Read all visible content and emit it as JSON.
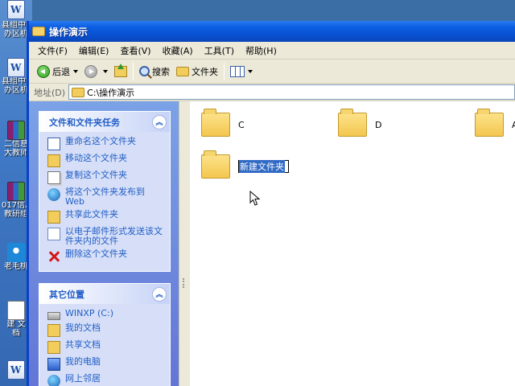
{
  "desktop": {
    "icons": [
      {
        "label": "",
        "type": "word"
      },
      {
        "label": "县组中学",
        "type": "word2"
      },
      {
        "label": "办区机",
        "type": "word2"
      },
      {
        "label": "县组中学",
        "type": "word"
      },
      {
        "label": "办区机",
        "type": "word"
      },
      {
        "label": "二信息",
        "type": "rar"
      },
      {
        "label": "大教师",
        "type": "rar"
      },
      {
        "label": "017信息",
        "type": "rar"
      },
      {
        "label": "教研组",
        "type": "rar"
      },
      {
        "label": "老毛桃",
        "type": "qq"
      },
      {
        "label": "建 文",
        "type": "doc"
      },
      {
        "label": "档",
        "type": "doc"
      },
      {
        "label": "",
        "type": "word"
      }
    ]
  },
  "window": {
    "title": "操作演示",
    "menu": [
      "文件(F)",
      "编辑(E)",
      "查看(V)",
      "收藏(A)",
      "工具(T)",
      "帮助(H)"
    ],
    "toolbar": {
      "back_label": "后退",
      "search_label": "搜索",
      "folders_label": "文件夹"
    },
    "address": {
      "label": "地址(D)",
      "path": "C:\\操作演示"
    }
  },
  "taskpane": {
    "file_tasks": {
      "title": "文件和文件夹任务",
      "items": [
        {
          "text": "重命名这个文件夹",
          "icon": "rename-icon"
        },
        {
          "text": "移动这个文件夹",
          "icon": "move-icon"
        },
        {
          "text": "复制这个文件夹",
          "icon": "copy-icon"
        },
        {
          "text": "将这个文件夹发布到Web",
          "icon": "web-publish-icon"
        },
        {
          "text": "共享此文件夹",
          "icon": "share-icon"
        },
        {
          "text": "以电子邮件形式发送该文件夹内的文件",
          "icon": "email-icon"
        },
        {
          "text": "删除这个文件夹",
          "icon": "delete-icon"
        }
      ]
    },
    "other_places": {
      "title": "其它位置",
      "items": [
        {
          "text": "WINXP (C:)",
          "icon": "drive-icon"
        },
        {
          "text": "我的文档",
          "icon": "my-documents-icon"
        },
        {
          "text": "共享文档",
          "icon": "shared-documents-icon"
        },
        {
          "text": "我的电脑",
          "icon": "my-computer-icon"
        },
        {
          "text": "网上邻居",
          "icon": "network-places-icon"
        }
      ]
    }
  },
  "files": [
    {
      "name": "C"
    },
    {
      "name": "D"
    },
    {
      "name": "A"
    },
    {
      "name": "新建文件夹",
      "renaming": true
    }
  ]
}
